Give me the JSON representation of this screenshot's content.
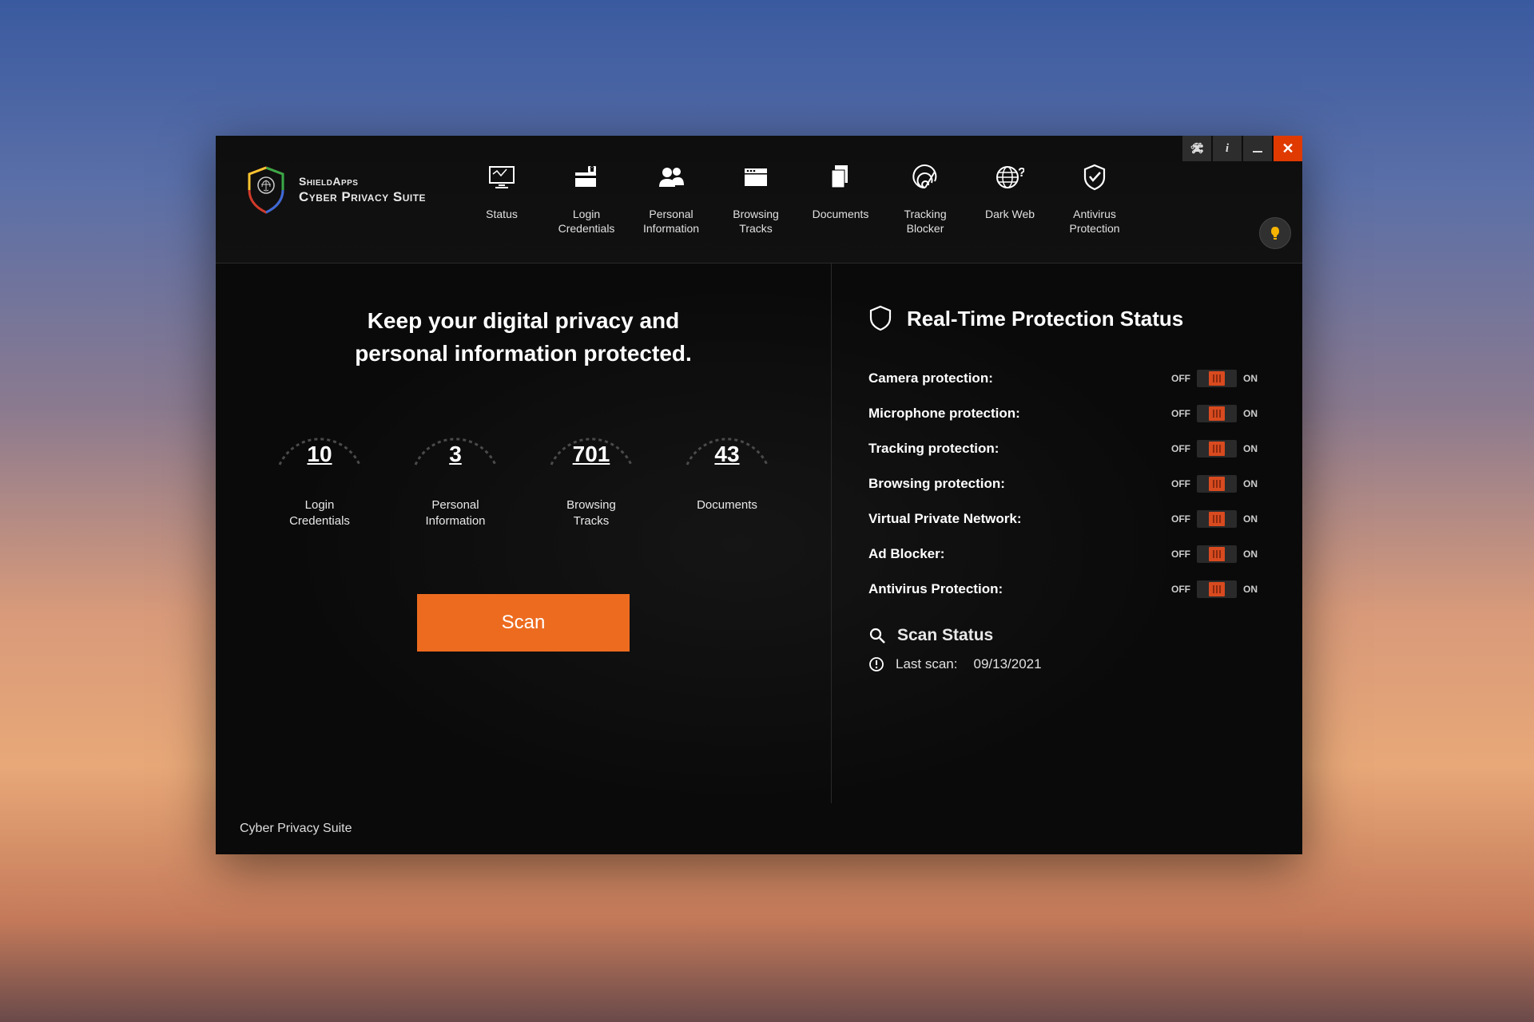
{
  "brand": {
    "line1": "ShieldApps",
    "line2": "Cyber Privacy Suite"
  },
  "nav": {
    "items": [
      {
        "label": "Status"
      },
      {
        "label": "Login\nCredentials"
      },
      {
        "label": "Personal\nInformation"
      },
      {
        "label": "Browsing\nTracks"
      },
      {
        "label": "Documents"
      },
      {
        "label": "Tracking\nBlocker"
      },
      {
        "label": "Dark Web"
      },
      {
        "label": "Antivirus\nProtection"
      }
    ]
  },
  "tagline": "Keep your digital privacy and\npersonal information protected.",
  "gauges": [
    {
      "value": "10",
      "label": "Login\nCredentials"
    },
    {
      "value": "3",
      "label": "Personal\nInformation"
    },
    {
      "value": "701",
      "label": "Browsing\nTracks"
    },
    {
      "value": "43",
      "label": "Documents"
    }
  ],
  "scan_button": "Scan",
  "realtime": {
    "title": "Real-Time Protection Status",
    "off_label": "OFF",
    "on_label": "ON",
    "items": [
      {
        "label": "Camera protection:"
      },
      {
        "label": "Microphone protection:"
      },
      {
        "label": "Tracking protection:"
      },
      {
        "label": "Browsing protection:"
      },
      {
        "label": "Virtual Private Network:"
      },
      {
        "label": "Ad Blocker:"
      },
      {
        "label": "Antivirus Protection:"
      }
    ]
  },
  "scan_status": {
    "title": "Scan Status",
    "last_scan_label": "Last scan:",
    "last_scan_date": "09/13/2021"
  },
  "footer": "Cyber Privacy Suite"
}
